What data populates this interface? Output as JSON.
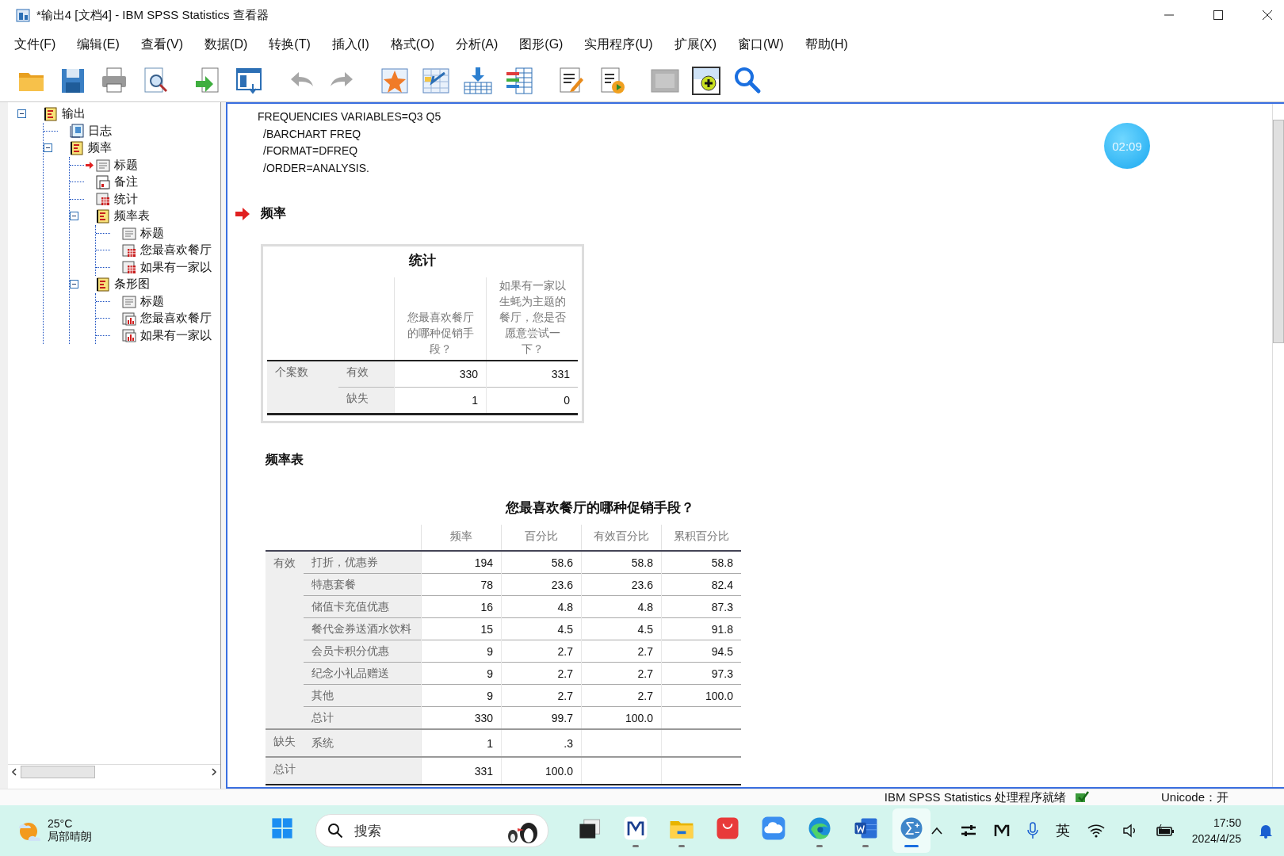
{
  "window": {
    "title": "*输出4 [文档4] - IBM SPSS Statistics 查看器"
  },
  "menu": [
    "文件(F)",
    "编辑(E)",
    "查看(V)",
    "数据(D)",
    "转换(T)",
    "插入(I)",
    "格式(O)",
    "分析(A)",
    "图形(G)",
    "实用程序(U)",
    "扩展(X)",
    "窗口(W)",
    "帮助(H)"
  ],
  "toolbar": [
    {
      "kind": "open",
      "disabled": false
    },
    {
      "kind": "save",
      "disabled": false
    },
    {
      "kind": "print",
      "disabled": false
    },
    {
      "kind": "preview",
      "disabled": false
    },
    {
      "kind": "export",
      "disabled": false
    },
    {
      "kind": "goto",
      "disabled": false
    },
    {
      "kind": "undo",
      "disabled": true
    },
    {
      "kind": "redo",
      "disabled": true
    },
    {
      "kind": "star",
      "disabled": false
    },
    {
      "kind": "tablearrow",
      "disabled": false
    },
    {
      "kind": "insert",
      "disabled": false
    },
    {
      "kind": "variables",
      "disabled": false
    },
    {
      "kind": "edit",
      "disabled": false
    },
    {
      "kind": "run",
      "disabled": false
    },
    {
      "kind": "panel",
      "disabled": true
    },
    {
      "kind": "add",
      "disabled": false
    },
    {
      "kind": "search",
      "disabled": false
    }
  ],
  "tree": [
    {
      "label": "输出",
      "kind": "book",
      "expanded": true,
      "current": false,
      "children": [
        {
          "label": "日志",
          "kind": "log",
          "current": false
        },
        {
          "label": "频率",
          "kind": "book",
          "expanded": true,
          "current": false,
          "children": [
            {
              "label": "标题",
              "kind": "title",
              "current": true
            },
            {
              "label": "备注",
              "kind": "notes",
              "current": false
            },
            {
              "label": "统计",
              "kind": "table",
              "current": false
            },
            {
              "label": "频率表",
              "kind": "book",
              "expanded": true,
              "current": false,
              "children": [
                {
                  "label": "标题",
                  "kind": "title",
                  "current": false
                },
                {
                  "label": "您最喜欢餐厅",
                  "kind": "table",
                  "current": false
                },
                {
                  "label": "如果有一家以",
                  "kind": "table",
                  "current": false
                }
              ]
            },
            {
              "label": "条形图",
              "kind": "book",
              "expanded": true,
              "current": false,
              "children": [
                {
                  "label": "标题",
                  "kind": "title",
                  "current": false
                },
                {
                  "label": "您最喜欢餐厅",
                  "kind": "chart",
                  "current": false
                },
                {
                  "label": "如果有一家以",
                  "kind": "chart",
                  "current": false
                }
              ]
            }
          ]
        }
      ]
    }
  ],
  "syntax": [
    "FREQUENCIES VARIABLES=Q3 Q5",
    "/BARCHART FREQ",
    "/FORMAT=DFREQ",
    "/ORDER=ANALYSIS."
  ],
  "timer": "02:09",
  "heading": {
    "text": "频率",
    "current": true
  },
  "stats_table": {
    "title": "统计",
    "columns": [
      "您最喜欢餐厅的哪种促销手段？",
      "如果有一家以生蚝为主题的餐厅，您是否愿意尝试一下？"
    ],
    "rows": [
      {
        "group": "个案数",
        "label": "有效",
        "values": [
          "330",
          "331"
        ]
      },
      {
        "label": "缺失",
        "values": [
          "1",
          "0"
        ]
      }
    ]
  },
  "freq_heading": "频率表",
  "freq_table": {
    "title": "您最喜欢餐厅的哪种促销手段？",
    "columns": [
      "频率",
      "百分比",
      "有效百分比",
      "累积百分比"
    ],
    "rows": [
      {
        "group": "有效",
        "label": "打折，优惠券",
        "values": [
          "194",
          "58.6",
          "58.8",
          "58.8"
        ]
      },
      {
        "label": "特惠套餐",
        "values": [
          "78",
          "23.6",
          "23.6",
          "82.4"
        ]
      },
      {
        "label": "储值卡充值优惠",
        "values": [
          "16",
          "4.8",
          "4.8",
          "87.3"
        ]
      },
      {
        "label": "餐代金券送酒水饮料",
        "values": [
          "15",
          "4.5",
          "4.5",
          "91.8"
        ]
      },
      {
        "label": "会员卡积分优惠",
        "values": [
          "9",
          "2.7",
          "2.7",
          "94.5"
        ]
      },
      {
        "label": "纪念小礼品赠送",
        "values": [
          "9",
          "2.7",
          "2.7",
          "97.3"
        ]
      },
      {
        "label": "其他",
        "values": [
          "9",
          "2.7",
          "2.7",
          "100.0"
        ]
      },
      {
        "label": "总计",
        "values": [
          "330",
          "99.7",
          "100.0"
        ]
      },
      {
        "group": "缺失",
        "label": "系统",
        "values": [
          "1",
          ".3"
        ]
      },
      {
        "group": "总计",
        "values": [
          "331",
          "100.0"
        ]
      }
    ]
  },
  "status": {
    "text": "IBM SPSS Statistics 处理程序就绪",
    "unicode": "Unicode：开"
  },
  "taskbar": {
    "weather": {
      "temp": "25°C",
      "desc": "局部晴朗"
    },
    "search": {
      "placeholder": "搜索"
    },
    "apps": [
      {
        "kind": "start",
        "running": false,
        "selected": false
      },
      {
        "kind": "taskview",
        "running": false,
        "selected": false
      },
      {
        "kind": "mi",
        "running": true,
        "selected": false
      },
      {
        "kind": "files",
        "running": true,
        "selected": false
      },
      {
        "kind": "store",
        "running": false,
        "selected": false
      },
      {
        "kind": "cloud",
        "running": false,
        "selected": false
      },
      {
        "kind": "edge",
        "running": true,
        "selected": false
      },
      {
        "kind": "word",
        "running": true,
        "selected": false
      },
      {
        "kind": "spss",
        "running": true,
        "selected": true
      }
    ],
    "ime": "英",
    "time": "17:50",
    "date": "2024/4/25"
  }
}
